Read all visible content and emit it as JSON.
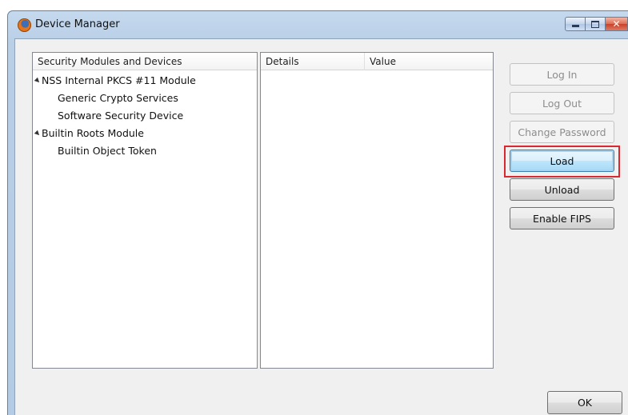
{
  "window": {
    "title": "Device Manager",
    "icon": "firefox-icon"
  },
  "modules_panel": {
    "header": "Security Modules and Devices",
    "modules": [
      {
        "label": "NSS Internal PKCS #11 Module",
        "children": [
          "Generic Crypto Services",
          "Software Security Device"
        ]
      },
      {
        "label": "Builtin Roots Module",
        "children": [
          "Builtin Object Token"
        ]
      }
    ]
  },
  "details_panel": {
    "col_details": "Details",
    "col_value": "Value"
  },
  "buttons": {
    "log_in": "Log In",
    "log_out": "Log Out",
    "change_password": "Change Password",
    "load": "Load",
    "unload": "Unload",
    "enable_fips": "Enable FIPS",
    "ok": "OK"
  },
  "colors": {
    "highlight": "#d9282f",
    "titlebar": "#b9cfe6"
  }
}
